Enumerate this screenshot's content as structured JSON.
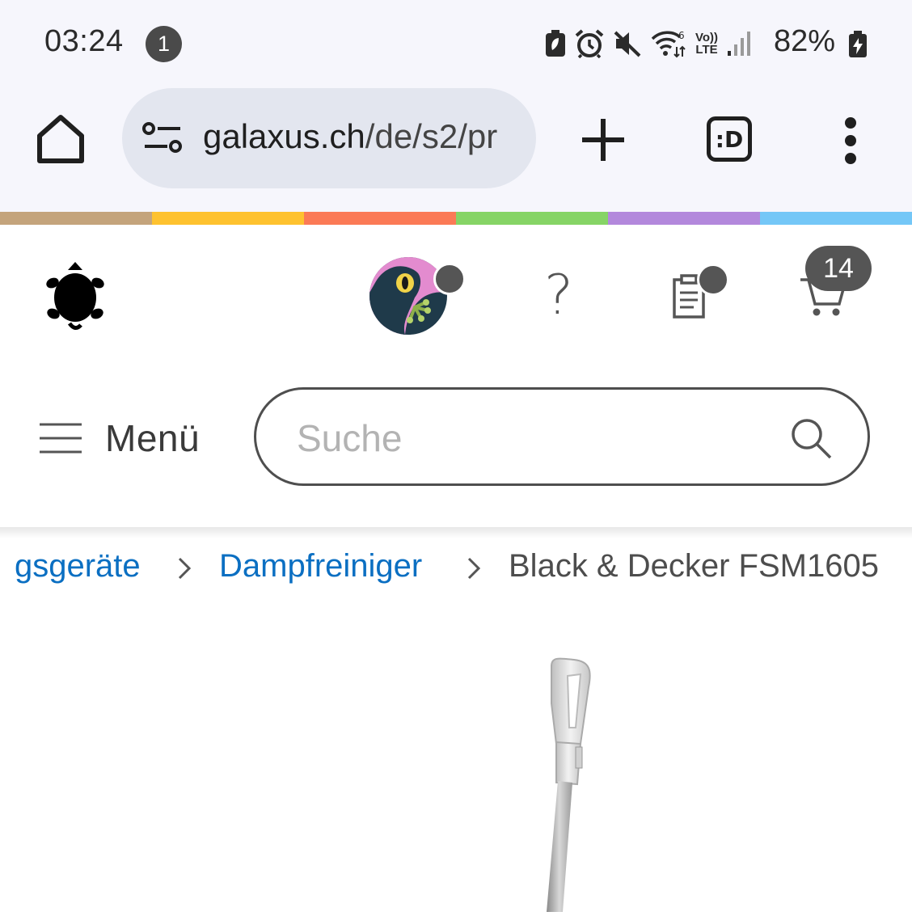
{
  "status_bar": {
    "time": "03:24",
    "notification_count": "1",
    "battery_percent": "82%",
    "icons": [
      "battery-saver-icon",
      "alarm-icon",
      "mute-icon",
      "wifi-6-icon",
      "volte-icon",
      "signal-icon",
      "battery-charging-icon"
    ],
    "volte_label_top": "Vo))",
    "volte_label_bottom": "LTE"
  },
  "browser": {
    "url_domain": "galaxus.ch",
    "url_path": "/de/s2/pr",
    "tab_switcher_label": ":D",
    "icons": [
      "home-icon",
      "site-settings-icon",
      "plus-icon",
      "more-vert-icon"
    ]
  },
  "stripe_colors": [
    "#c4a47c",
    "#fec22f",
    "#fb7a56",
    "#86d466",
    "#b388dc",
    "#74c7f7"
  ],
  "site_header": {
    "help_label": "?",
    "cart_count": "14",
    "icons": [
      "turtle-logo-icon",
      "avatar",
      "help-icon",
      "orders-icon",
      "cart-icon"
    ]
  },
  "nav": {
    "menu_label": "Menü",
    "search_placeholder": "Suche",
    "icons": [
      "hamburger-icon",
      "search-icon"
    ]
  },
  "breadcrumb": {
    "items": [
      {
        "label": "gsgeräte",
        "type": "link"
      },
      {
        "label": "Dampfreiniger",
        "type": "link"
      },
      {
        "label": "Black & Decker FSM1605",
        "type": "current"
      }
    ],
    "separator_icon": "chevron-right-icon"
  },
  "colors": {
    "link": "#0b6fc2",
    "badge": "#555555",
    "browser_bg": "#f6f6fc",
    "url_pill": "#e3e6ef"
  }
}
